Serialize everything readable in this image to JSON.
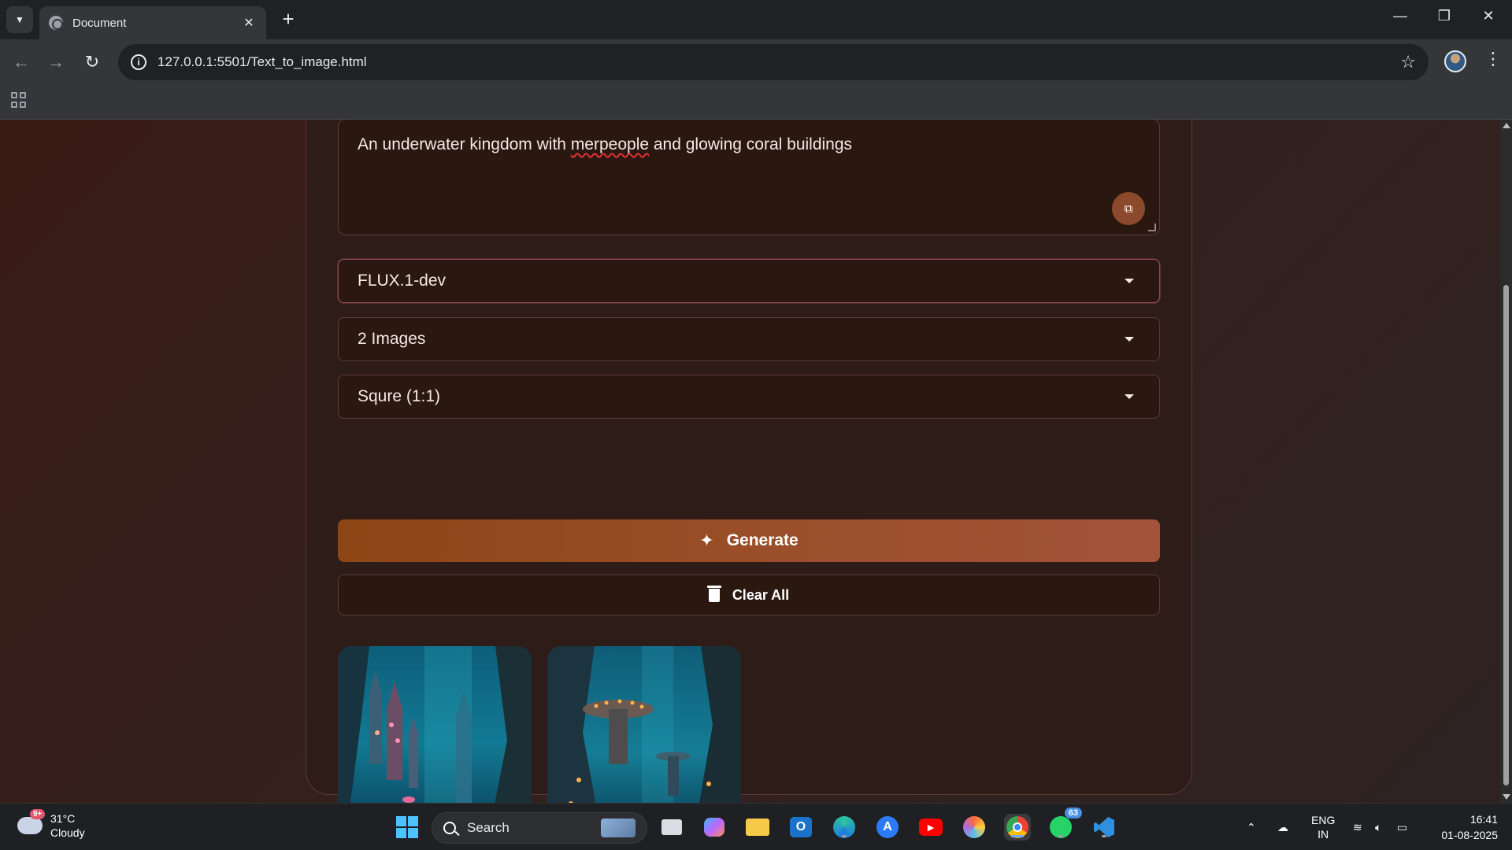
{
  "browser": {
    "tab_title": "Document",
    "url": "127.0.0.1:5501/Text_to_image.html",
    "new_tab_symbol": "+",
    "close_symbol": "✕"
  },
  "prompt": {
    "text_before": "An underwater kingdom with ",
    "text_misspelled": "merpeople",
    "text_after": " and glowing coral buildings"
  },
  "selects": {
    "model": "FLUX.1-dev",
    "count": "2 Images",
    "ratio": "Squre (1:1)"
  },
  "buttons": {
    "generate": "Generate",
    "clear_all": "Clear All"
  },
  "gallery": {
    "images": [
      "underwater-castle-image",
      "underwater-coral-city-image"
    ]
  },
  "taskbar": {
    "weather_temp": "31°C",
    "weather_desc": "Cloudy",
    "weather_badge": "9+",
    "search_label": "Search",
    "whatsapp_badge": "63",
    "lang_top": "ENG",
    "lang_bottom": "IN",
    "time": "16:41",
    "date": "01-08-2025"
  },
  "colors": {
    "accent_generate": "#9a4e28",
    "page_bg": "#33201d",
    "card_bg": "#2e1c19"
  }
}
